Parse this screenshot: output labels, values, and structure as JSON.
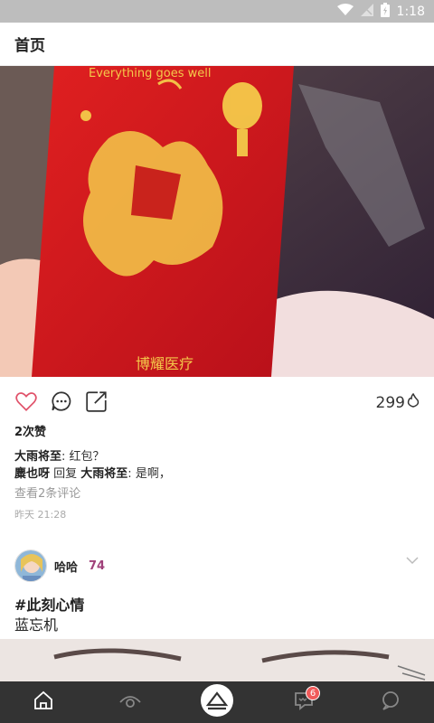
{
  "status": {
    "time": "1:18"
  },
  "appbar": {
    "title": "首页"
  },
  "post1": {
    "image_alt": "红包 photo",
    "image_text_top": "Everything goes well",
    "image_text_bottom": "博耀医疗",
    "views": "299",
    "likes": "2次赞",
    "comments": [
      {
        "user": "大雨将至",
        "sep": ": ",
        "text": "红包？"
      },
      {
        "user": "麋也呀",
        "reply_word": " 回复 ",
        "reply_to": "大雨将至",
        "sep": ": ",
        "text": "是啊，"
      }
    ],
    "view_all": "查看2条评论",
    "time": "昨天 21:28"
  },
  "post2": {
    "username": "哈哈",
    "level": "74",
    "tag": "#此刻心情",
    "caption": "蓝忘机"
  },
  "tabbar": {
    "badge": "6"
  },
  "colors": {
    "accent": "#a0417a",
    "badge": "#f05a5a",
    "tabbar": "#333333"
  }
}
